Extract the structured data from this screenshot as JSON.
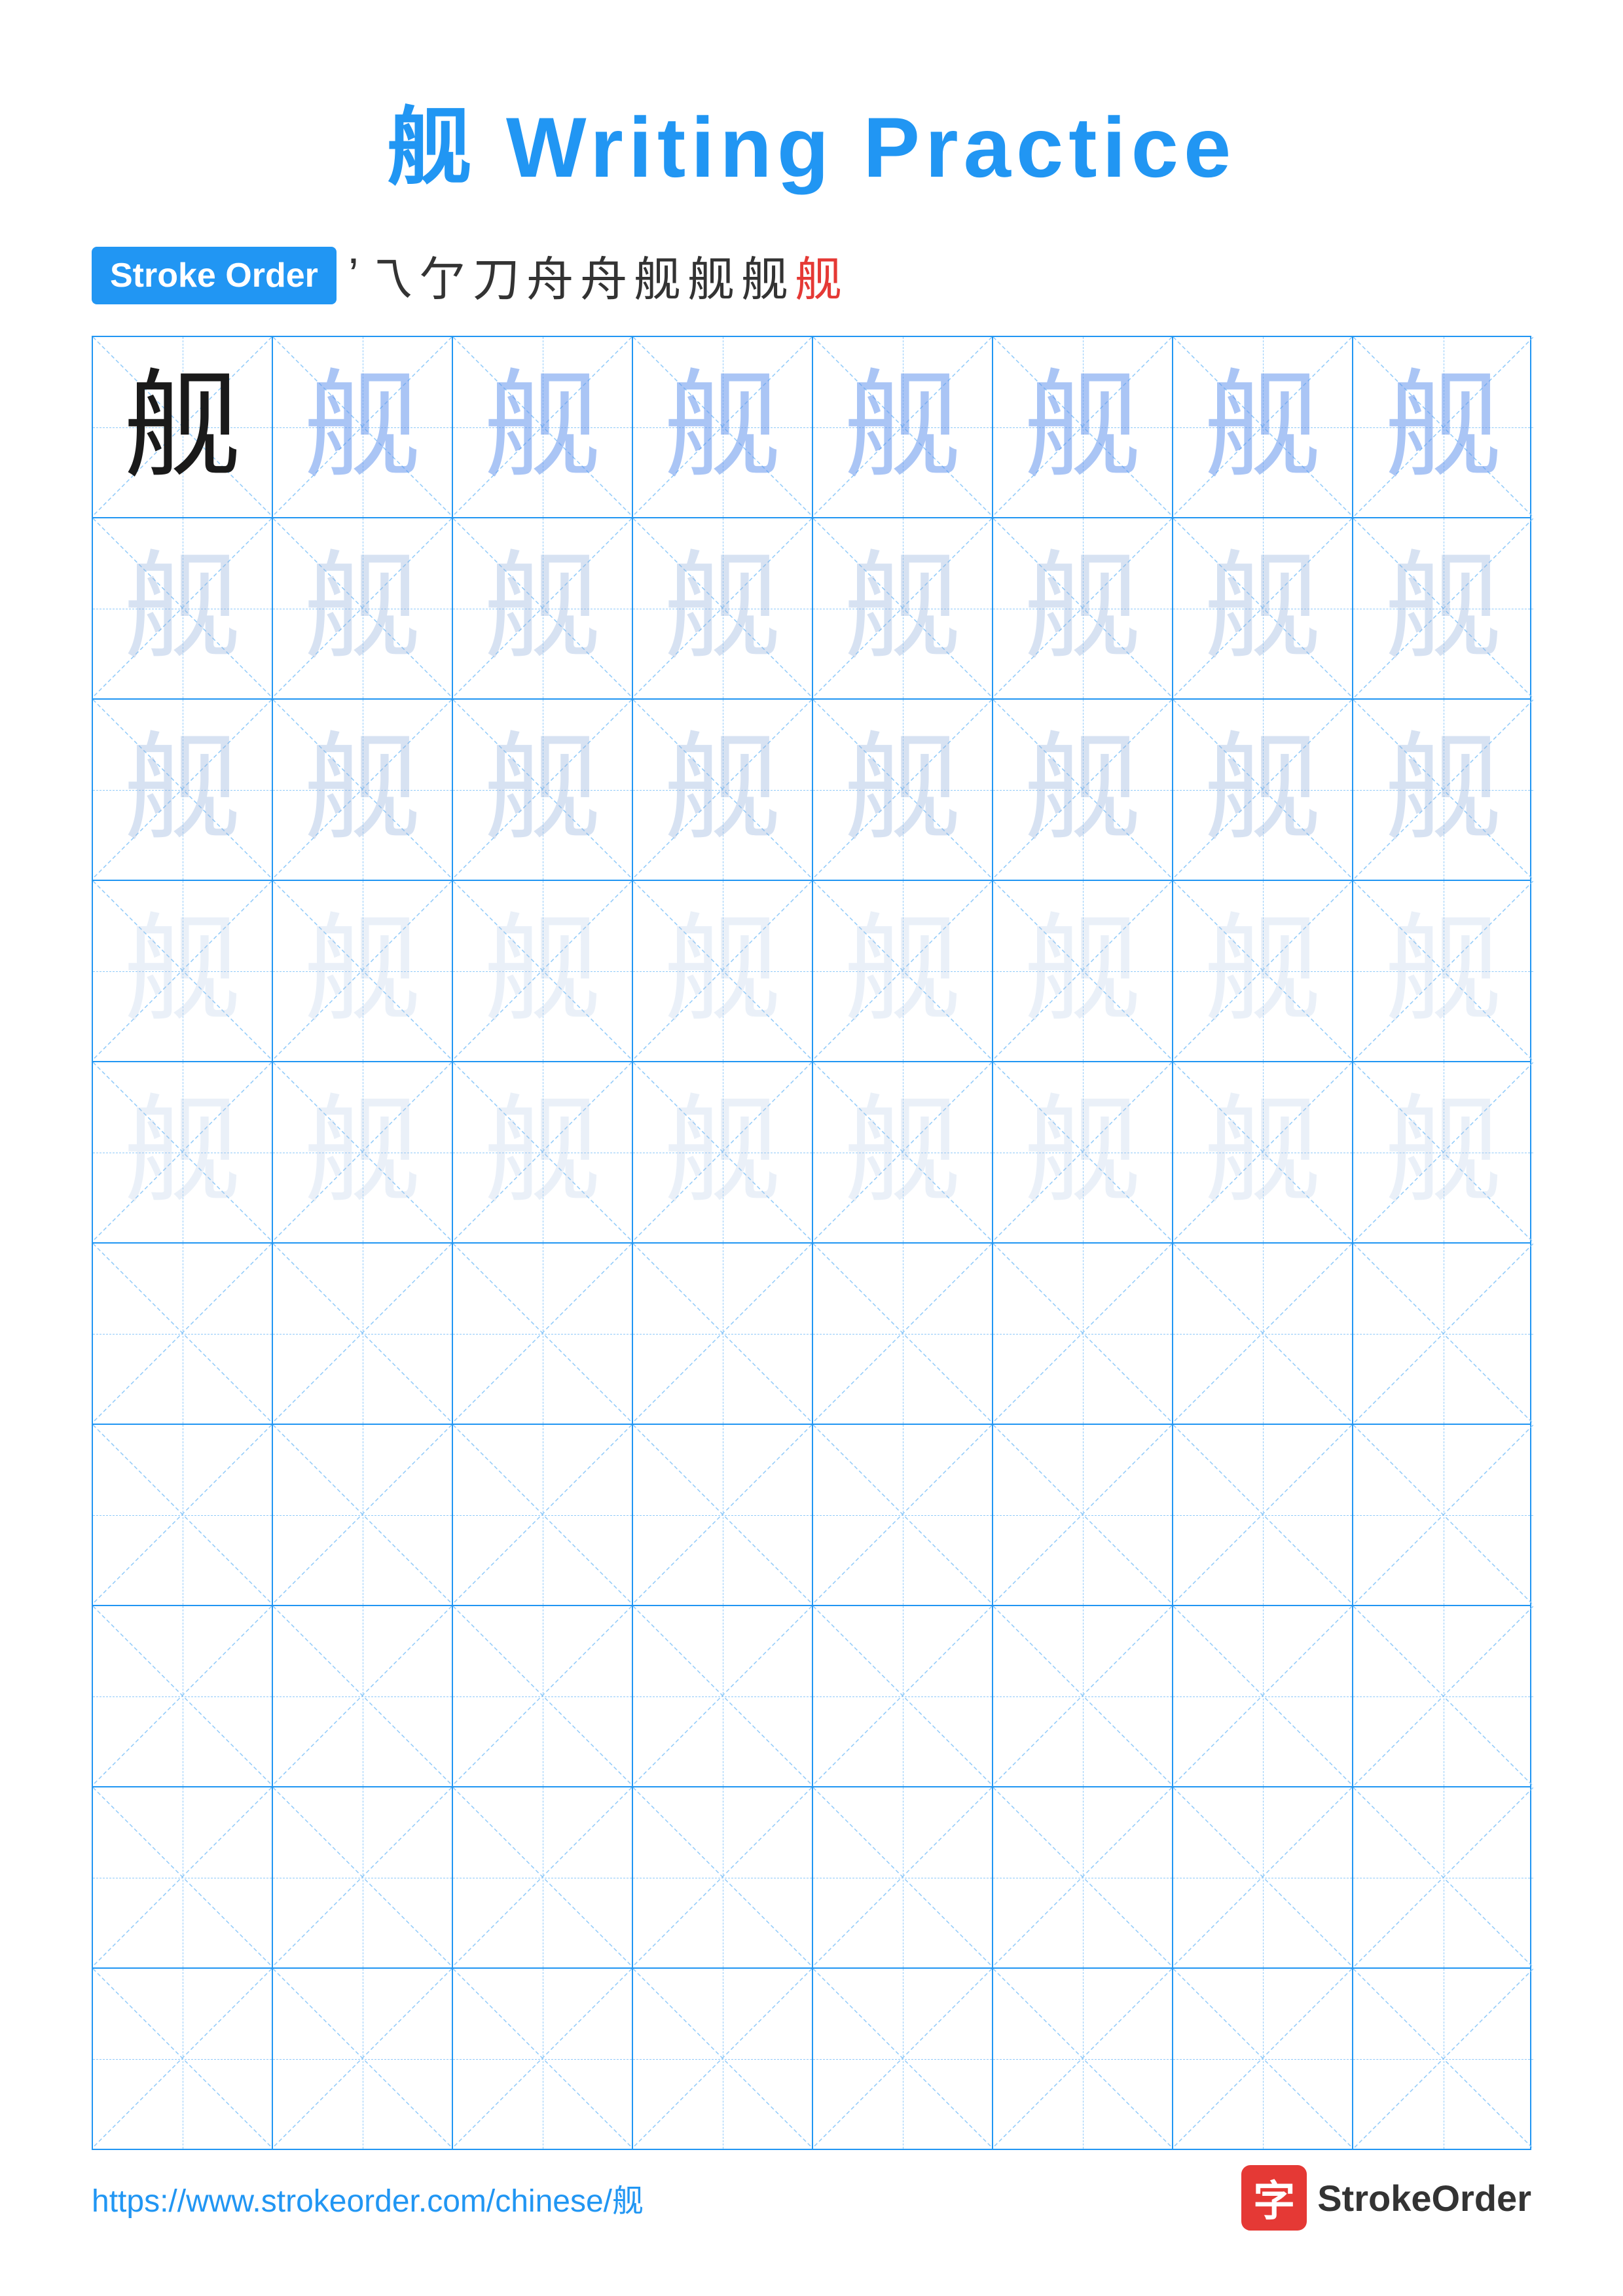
{
  "title": "舰 Writing Practice",
  "stroke_order": {
    "label": "Stroke Order",
    "strokes": [
      "'",
      "⼃",
      "⺄",
      "⺅",
      "⺆",
      "⺈",
      "⺊",
      "⺍",
      "⺏",
      "舰"
    ]
  },
  "character": "舰",
  "grid": {
    "rows": 10,
    "cols": 8
  },
  "footer": {
    "url": "https://www.strokeorder.com/chinese/舰",
    "logo_char": "字",
    "logo_text": "StrokeOrder"
  },
  "colors": {
    "accent": "#2196F3",
    "red": "#e53935",
    "dark_char": "#1a1a1a",
    "light1": "rgba(100,149,237,0.55)",
    "light2": "rgba(150,180,220,0.38)",
    "light3": "rgba(180,200,230,0.28)"
  }
}
